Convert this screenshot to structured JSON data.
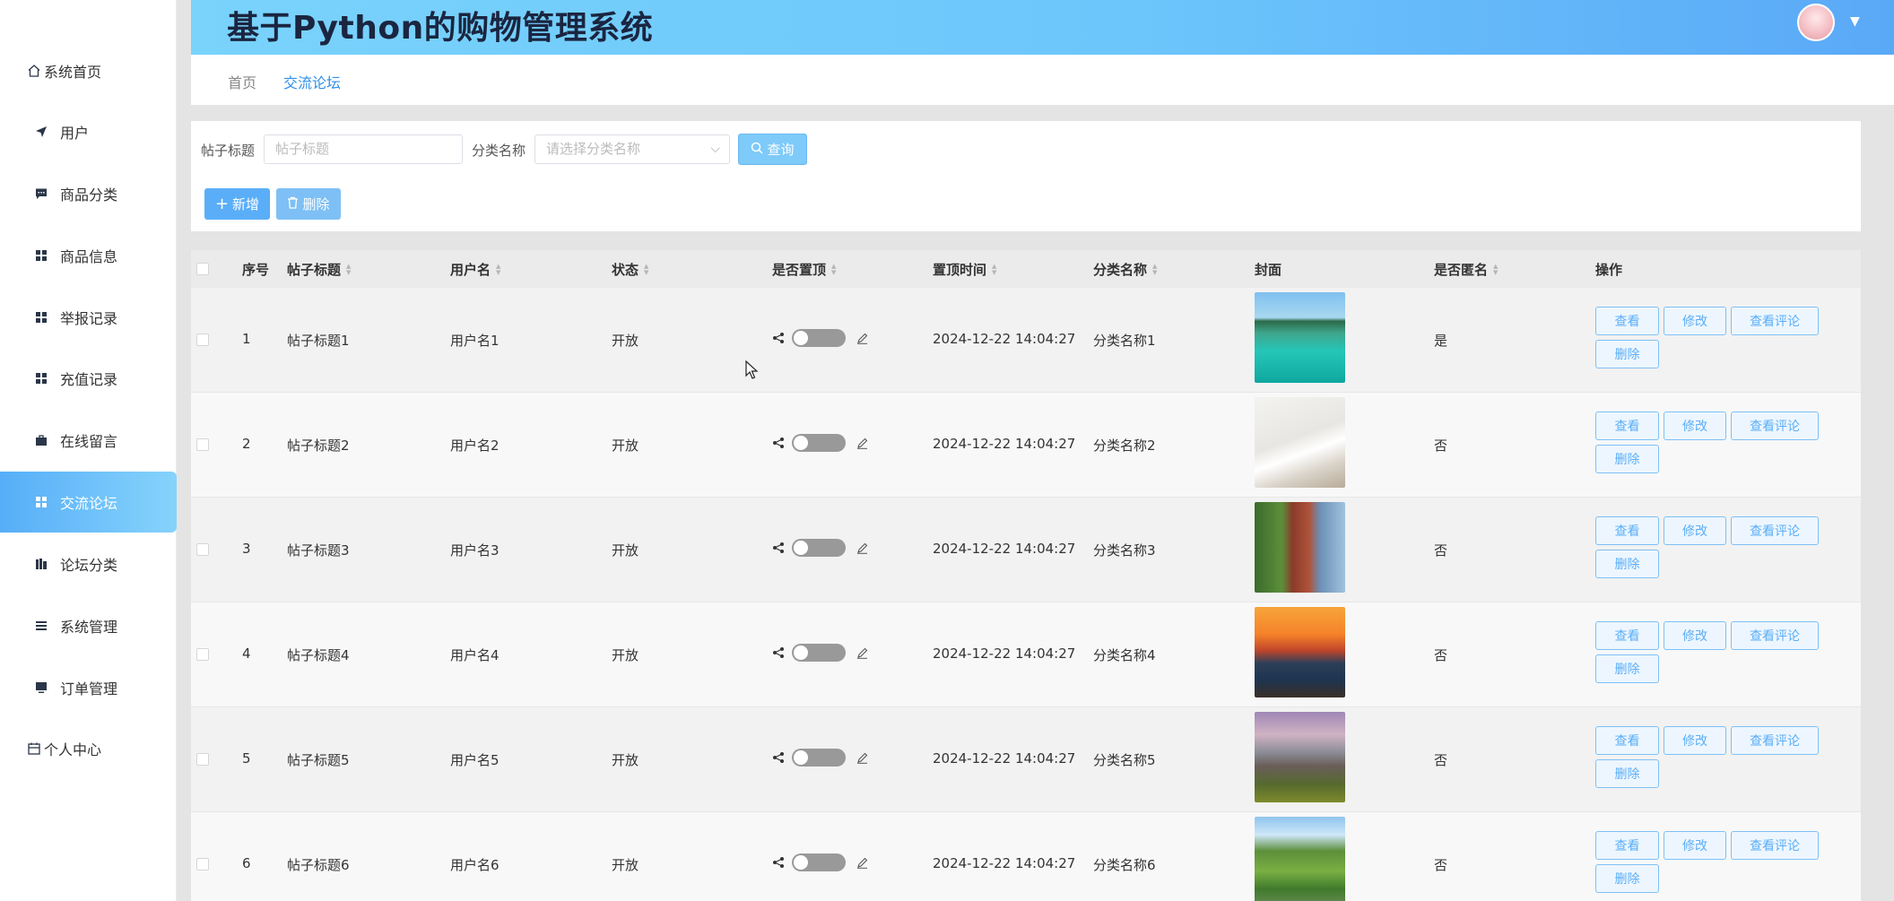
{
  "app": {
    "title": "基于Python的购物管理系统"
  },
  "sidebar": {
    "items": [
      {
        "label": "系统首页",
        "icon": "home-icon"
      },
      {
        "label": "用户",
        "icon": "send-icon"
      },
      {
        "label": "商品分类",
        "icon": "chat-icon"
      },
      {
        "label": "商品信息",
        "icon": "grid-icon"
      },
      {
        "label": "举报记录",
        "icon": "grid-icon"
      },
      {
        "label": "充值记录",
        "icon": "grid-icon"
      },
      {
        "label": "在线留言",
        "icon": "briefcase-icon"
      },
      {
        "label": "交流论坛",
        "icon": "grid-icon",
        "active": true
      },
      {
        "label": "论坛分类",
        "icon": "book-icon"
      },
      {
        "label": "系统管理",
        "icon": "list-icon"
      },
      {
        "label": "订单管理",
        "icon": "monitor-icon"
      },
      {
        "label": "个人中心",
        "icon": "calendar-icon"
      }
    ]
  },
  "breadcrumb": {
    "home": "首页",
    "current": "交流论坛"
  },
  "search": {
    "title_label": "帖子标题",
    "title_placeholder": "帖子标题",
    "category_label": "分类名称",
    "category_placeholder": "请选择分类名称",
    "query_button": "查询"
  },
  "actions": {
    "add": "新增",
    "delete": "删除"
  },
  "table": {
    "headers": {
      "index": "序号",
      "title": "帖子标题",
      "user": "用户名",
      "status": "状态",
      "pinned": "是否置顶",
      "pin_time": "置顶时间",
      "category": "分类名称",
      "cover": "封面",
      "anonymous": "是否匿名",
      "ops": "操作"
    },
    "rows": [
      {
        "index": "1",
        "title": "帖子标题1",
        "user": "用户名1",
        "status": "开放",
        "pinned": false,
        "pin_time": "2024-12-22 14:04:27",
        "category": "分类名称1",
        "cover": "tropical-overwater-villas",
        "anonymous": "是"
      },
      {
        "index": "2",
        "title": "帖子标题2",
        "user": "用户名2",
        "status": "开放",
        "pinned": false,
        "pin_time": "2024-12-22 14:04:27",
        "category": "分类名称2",
        "cover": "coffee-cup-book",
        "anonymous": "否"
      },
      {
        "index": "3",
        "title": "帖子标题3",
        "user": "用户名3",
        "status": "开放",
        "pinned": false,
        "pin_time": "2024-12-22 14:04:27",
        "category": "分类名称3",
        "cover": "clock-tower",
        "anonymous": "否"
      },
      {
        "index": "4",
        "title": "帖子标题4",
        "user": "用户名4",
        "status": "开放",
        "pinned": false,
        "pin_time": "2024-12-22 14:04:27",
        "category": "分类名称4",
        "cover": "sunset-rocky-shore",
        "anonymous": "否"
      },
      {
        "index": "5",
        "title": "帖子标题5",
        "user": "用户名5",
        "status": "开放",
        "pinned": false,
        "pin_time": "2024-12-22 14:04:27",
        "category": "分类名称5",
        "cover": "mountain-valley",
        "anonymous": "否"
      },
      {
        "index": "6",
        "title": "帖子标题6",
        "user": "用户名6",
        "status": "开放",
        "pinned": false,
        "pin_time": "2024-12-22 14:04:27",
        "category": "分类名称6",
        "cover": "green-valley-stream",
        "anonymous": "否"
      }
    ],
    "row_buttons": {
      "view": "查看",
      "edit": "修改",
      "view_comments": "查看评论",
      "delete": "删除"
    }
  },
  "colors": {
    "accent": "#5aaef8",
    "header_start": "#79d3fb",
    "header_end": "#5aa9f7",
    "title_text": "#1b2540",
    "breadcrumb_active": "#2f8fe8"
  }
}
